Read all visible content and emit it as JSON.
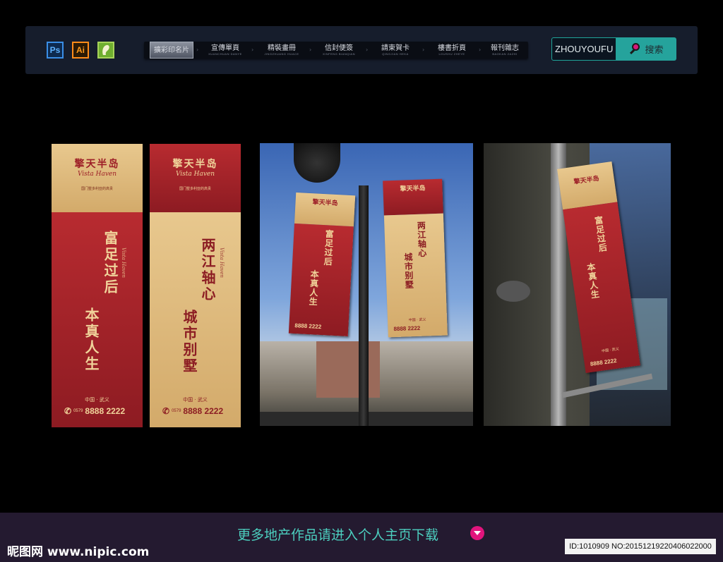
{
  "toolbar": {
    "apps": [
      "Ps",
      "Ai"
    ],
    "nav": [
      {
        "label": "擴彩印名片",
        "sub": ""
      },
      {
        "label": "宣傳單頁",
        "sub": "XUANCHUAN DANYE"
      },
      {
        "label": "精裝畫冊",
        "sub": "JINGZHUANG HUACE"
      },
      {
        "label": "信封便簽",
        "sub": "XINFENG BIANQIAN"
      },
      {
        "label": "請柬賀卡",
        "sub": "QINGJIAN HEKA"
      },
      {
        "label": "樓書折頁",
        "sub": "LOUSHU ZHEYE"
      },
      {
        "label": "報刊雜志",
        "sub": "BAOKAN ZAZHI"
      }
    ],
    "search_value": "ZHOUYOUFU",
    "search_button": "搜索"
  },
  "banners": {
    "brand": "擎天半岛",
    "brand_script": "Vista Haven",
    "tagline": "国门墅多利亚的高贵",
    "slogan1_a": "富足过后",
    "slogan1_b": "本真人生",
    "slogan2_a": "两江轴心",
    "slogan2_b": "城市别墅",
    "location": "中国 · 武义",
    "phone_code": "0579",
    "phone": "8888 2222"
  },
  "footer": {
    "text": "更多地产作品请进入个人主页下载",
    "watermark": "昵图网 www.nipic.com",
    "image_id": "ID:1010909 NO:20151219220406022000"
  },
  "colors": {
    "red": "#a8242b",
    "gold": "#e0bd7e",
    "teal": "#25a39c",
    "magenta": "#e2147d"
  }
}
